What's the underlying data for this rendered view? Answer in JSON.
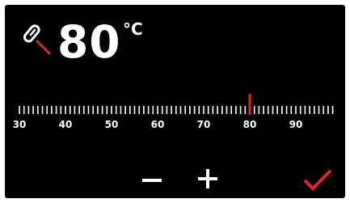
{
  "temperature": {
    "value": "80",
    "unit": "°C"
  },
  "scale": {
    "min": 30,
    "max": 98,
    "labels": [
      "30",
      "40",
      "50",
      "60",
      "70",
      "80",
      "90"
    ],
    "selected_value": 80,
    "marker_color": "#e8212b"
  },
  "controls": {
    "decrease_icon": "minus-icon",
    "increase_icon": "plus-icon",
    "confirm_icon": "checkmark-icon"
  },
  "colors": {
    "background": "#000000",
    "text": "#ffffff",
    "accent": "#e8212b"
  }
}
